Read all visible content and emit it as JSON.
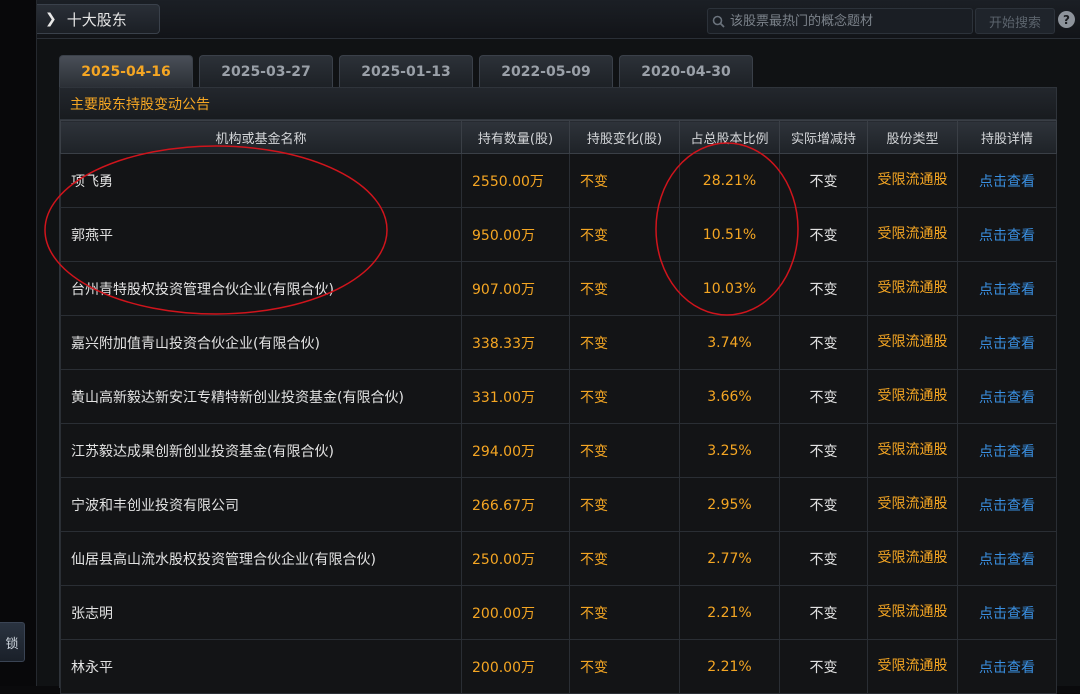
{
  "side_tab_label": "锁",
  "header": {
    "title": "十大股东",
    "arrow_glyph": "❯",
    "search_placeholder": "该股票最热门的概念题材",
    "search_button": "开始搜索",
    "help_glyph": "?"
  },
  "date_tabs": [
    "2025-04-16",
    "2025-03-27",
    "2025-01-13",
    "2022-05-09",
    "2020-04-30"
  ],
  "active_tab_index": 0,
  "section_title": "主要股东持股变动公告",
  "columns": [
    "机构或基金名称",
    "持有数量(股)",
    "持股变化(股)",
    "占总股本比例",
    "实际增减持",
    "股份类型",
    "持股详情"
  ],
  "rows": [
    {
      "name": "项飞勇",
      "shares": "2550.00万",
      "change": "不变",
      "ratio": "28.21%",
      "actual": "不变",
      "type": "受限流通股",
      "detail": "点击查看"
    },
    {
      "name": "郭燕平",
      "shares": "950.00万",
      "change": "不变",
      "ratio": "10.51%",
      "actual": "不变",
      "type": "受限流通股",
      "detail": "点击查看"
    },
    {
      "name": "台州青特股权投资管理合伙企业(有限合伙)",
      "shares": "907.00万",
      "change": "不变",
      "ratio": "10.03%",
      "actual": "不变",
      "type": "受限流通股",
      "detail": "点击查看"
    },
    {
      "name": "嘉兴附加值青山投资合伙企业(有限合伙)",
      "shares": "338.33万",
      "change": "不变",
      "ratio": "3.74%",
      "actual": "不变",
      "type": "受限流通股",
      "detail": "点击查看"
    },
    {
      "name": "黄山高新毅达新安江专精特新创业投资基金(有限合伙)",
      "shares": "331.00万",
      "change": "不变",
      "ratio": "3.66%",
      "actual": "不变",
      "type": "受限流通股",
      "detail": "点击查看"
    },
    {
      "name": "江苏毅达成果创新创业投资基金(有限合伙)",
      "shares": "294.00万",
      "change": "不变",
      "ratio": "3.25%",
      "actual": "不变",
      "type": "受限流通股",
      "detail": "点击查看"
    },
    {
      "name": "宁波和丰创业投资有限公司",
      "shares": "266.67万",
      "change": "不变",
      "ratio": "2.95%",
      "actual": "不变",
      "type": "受限流通股",
      "detail": "点击查看"
    },
    {
      "name": "仙居县高山流水股权投资管理合伙企业(有限合伙)",
      "shares": "250.00万",
      "change": "不变",
      "ratio": "2.77%",
      "actual": "不变",
      "type": "受限流通股",
      "detail": "点击查看"
    },
    {
      "name": "张志明",
      "shares": "200.00万",
      "change": "不变",
      "ratio": "2.21%",
      "actual": "不变",
      "type": "受限流通股",
      "detail": "点击查看"
    },
    {
      "name": "林永平",
      "shares": "200.00万",
      "change": "不变",
      "ratio": "2.21%",
      "actual": "不变",
      "type": "受限流通股",
      "detail": "点击查看"
    }
  ],
  "colors": {
    "accent_orange": "#f5a623",
    "link_blue": "#3a8fe0",
    "annotation_red": "#d0141c"
  }
}
